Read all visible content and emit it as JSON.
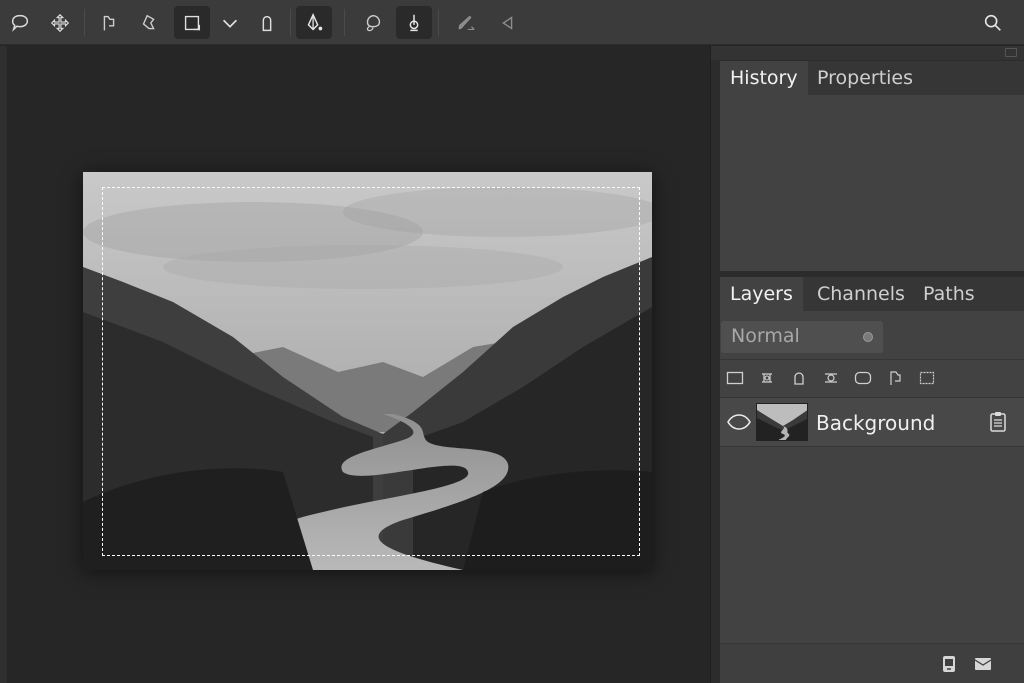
{
  "toolbar": {
    "tools": [
      {
        "name": "lasso-icon"
      },
      {
        "name": "move-icon"
      },
      {
        "name": "flag-icon"
      },
      {
        "name": "polygon-lasso-icon"
      },
      {
        "name": "rectangle-marquee-icon",
        "active": true
      },
      {
        "name": "chevron-down-icon"
      },
      {
        "name": "elliptical-marquee-icon"
      },
      {
        "name": "pen-tool-icon",
        "active": true
      },
      {
        "name": "lasso-shape-icon"
      },
      {
        "name": "anchor-point-icon",
        "active": true
      },
      {
        "name": "brush-icon",
        "dim": true
      },
      {
        "name": "back-arrow-icon",
        "dim": true
      },
      {
        "name": "search-icon"
      }
    ]
  },
  "panels": {
    "top_tabs": [
      "History",
      "Properties"
    ],
    "layers_tabs": [
      "Layers",
      "Channels",
      "Paths"
    ],
    "blend_mode": "Normal",
    "lock_icons": [
      "lock-pixels-icon",
      "lock-transparency-icon",
      "lock-shape-icon",
      "lock-position-icon",
      "lock-frame-icon",
      "lock-artboard-icon",
      "lock-all-icon"
    ],
    "layers": [
      {
        "name": "Background",
        "visible": true,
        "locked": true
      }
    ],
    "footer_icons": [
      "new-layer-icon",
      "delete-layer-icon"
    ]
  },
  "colors": {
    "toolbar_bg": "#3b3b3b",
    "canvas_bg": "#262626",
    "panel_bg": "#424242",
    "tab_bar_bg": "#363636"
  }
}
